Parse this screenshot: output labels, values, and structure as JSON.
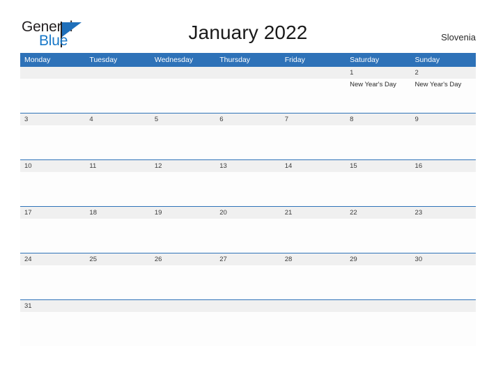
{
  "brand": {
    "name_top": "General",
    "name_bottom": "Blue",
    "top_color": "#231f20",
    "bottom_color": "#1878c8",
    "triangle_color": "#1f6fba"
  },
  "header": {
    "title": "January 2022",
    "country": "Slovenia"
  },
  "colors": {
    "header_blue": "#2e72b8",
    "daynum_band": "#f0f0f0",
    "rule_blue": "#2e72b8"
  },
  "calendar": {
    "weekdays": [
      "Monday",
      "Tuesday",
      "Wednesday",
      "Thursday",
      "Friday",
      "Saturday",
      "Sunday"
    ],
    "weeks": [
      {
        "days": [
          {
            "num": "",
            "events": []
          },
          {
            "num": "",
            "events": []
          },
          {
            "num": "",
            "events": []
          },
          {
            "num": "",
            "events": []
          },
          {
            "num": "",
            "events": []
          },
          {
            "num": "1",
            "events": [
              "New Year's Day"
            ]
          },
          {
            "num": "2",
            "events": [
              "New Year's Day"
            ]
          }
        ]
      },
      {
        "days": [
          {
            "num": "3",
            "events": []
          },
          {
            "num": "4",
            "events": []
          },
          {
            "num": "5",
            "events": []
          },
          {
            "num": "6",
            "events": []
          },
          {
            "num": "7",
            "events": []
          },
          {
            "num": "8",
            "events": []
          },
          {
            "num": "9",
            "events": []
          }
        ]
      },
      {
        "days": [
          {
            "num": "10",
            "events": []
          },
          {
            "num": "11",
            "events": []
          },
          {
            "num": "12",
            "events": []
          },
          {
            "num": "13",
            "events": []
          },
          {
            "num": "14",
            "events": []
          },
          {
            "num": "15",
            "events": []
          },
          {
            "num": "16",
            "events": []
          }
        ]
      },
      {
        "days": [
          {
            "num": "17",
            "events": []
          },
          {
            "num": "18",
            "events": []
          },
          {
            "num": "19",
            "events": []
          },
          {
            "num": "20",
            "events": []
          },
          {
            "num": "21",
            "events": []
          },
          {
            "num": "22",
            "events": []
          },
          {
            "num": "23",
            "events": []
          }
        ]
      },
      {
        "days": [
          {
            "num": "24",
            "events": []
          },
          {
            "num": "25",
            "events": []
          },
          {
            "num": "26",
            "events": []
          },
          {
            "num": "27",
            "events": []
          },
          {
            "num": "28",
            "events": []
          },
          {
            "num": "29",
            "events": []
          },
          {
            "num": "30",
            "events": []
          }
        ]
      },
      {
        "days": [
          {
            "num": "31",
            "events": []
          },
          {
            "num": "",
            "events": []
          },
          {
            "num": "",
            "events": []
          },
          {
            "num": "",
            "events": []
          },
          {
            "num": "",
            "events": []
          },
          {
            "num": "",
            "events": []
          },
          {
            "num": "",
            "events": []
          }
        ]
      }
    ]
  }
}
